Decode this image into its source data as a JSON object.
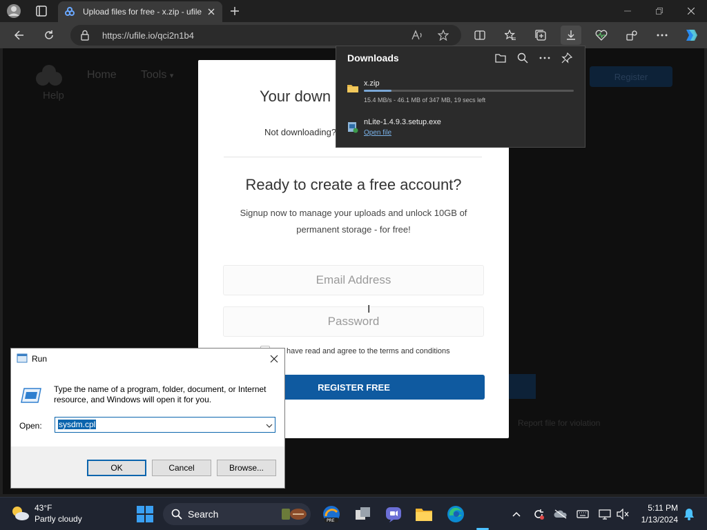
{
  "browser": {
    "tab": {
      "title": "Upload files for free - x.zip - ufile"
    },
    "address": {
      "url": "https://ufile.io/qci2n1b4"
    }
  },
  "site": {
    "logo_label": "Help",
    "nav": {
      "home": "Home",
      "tools": "Tools"
    },
    "register_label": "Register",
    "report_link": "Report file for violation"
  },
  "modal": {
    "heading": "Your down",
    "not_downloading": "Not downloading?",
    "account_title": "Ready to create a free account?",
    "account_desc": "Signup now to manage your uploads and unlock 10GB of permanent storage - for free!",
    "email_placeholder": "Email Address",
    "password_placeholder": "Password",
    "terms": "have read and agree to the terms and conditions",
    "register_button": "REGISTER FREE"
  },
  "downloads": {
    "title": "Downloads",
    "items": [
      {
        "name": "x.zip",
        "status": "15.4 MB/s - 46.1 MB of 347 MB, 19 secs left",
        "progress": 0.133
      },
      {
        "name": "nLite-1.4.9.3.setup.exe",
        "action": "Open file"
      }
    ]
  },
  "run_dialog": {
    "title": "Run",
    "description": "Type the name of a program, folder, document, or Internet resource, and Windows will open it for you.",
    "open_label": "Open:",
    "input_value": "sysdm.cpl",
    "buttons": {
      "ok": "OK",
      "cancel": "Cancel",
      "browse": "Browse..."
    }
  },
  "taskbar": {
    "weather": {
      "temp": "43°F",
      "condition": "Partly cloudy"
    },
    "search_label": "Search",
    "clock": {
      "time": "5:11 PM",
      "date": "1/13/2024"
    }
  },
  "colors": {
    "accent_blue": "#0f5aa0",
    "edge_accent": "#4cc2ff",
    "download_progress": "#7aa7d6"
  }
}
